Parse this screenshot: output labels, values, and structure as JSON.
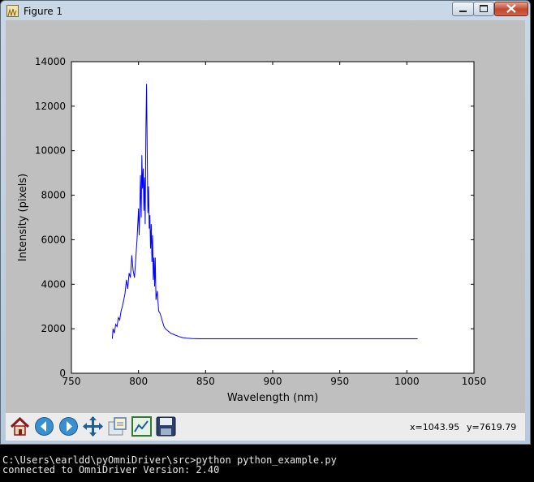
{
  "window": {
    "title": "Figure 1",
    "app_icon": "matplotlib-figure-icon"
  },
  "chart_data": {
    "type": "line",
    "title": "",
    "xlabel": "Wavelength (nm)",
    "ylabel": "Intensity (pixels)",
    "xlim": [
      750,
      1050
    ],
    "ylim": [
      0,
      14000
    ],
    "xticks": [
      "750",
      "800",
      "850",
      "900",
      "950",
      "1000",
      "1050"
    ],
    "yticks": [
      "0",
      "2000",
      "4000",
      "6000",
      "8000",
      "10000",
      "12000",
      "14000"
    ],
    "grid": false,
    "series": [
      {
        "color": "#0000ff",
        "x": [
          780.5,
          781,
          782,
          783,
          784,
          785,
          786,
          787,
          788,
          789,
          790,
          791,
          792,
          793,
          794,
          795,
          796,
          797,
          798,
          799,
          800,
          800.5,
          801,
          801.5,
          802,
          802.5,
          803,
          803.5,
          804,
          804.5,
          805,
          805.5,
          806,
          806.5,
          807,
          807.5,
          808,
          808.5,
          809,
          809.5,
          810,
          810.5,
          811,
          811.5,
          812,
          812.5,
          813,
          814,
          815,
          816,
          817,
          818,
          819,
          820,
          822,
          824,
          826,
          828,
          830,
          833,
          836,
          840,
          845,
          850,
          860,
          880,
          900,
          950,
          1000,
          1008
        ],
        "y": [
          1550,
          2000,
          1800,
          2200,
          2100,
          2500,
          2400,
          2800,
          3000,
          3300,
          3600,
          4200,
          3800,
          4500,
          4300,
          5300,
          4600,
          4300,
          5200,
          6100,
          7400,
          6200,
          7400,
          8900,
          7000,
          9800,
          8300,
          9200,
          7300,
          8800,
          6700,
          11000,
          13000,
          10000,
          7200,
          8400,
          6500,
          7100,
          5600,
          6700,
          5000,
          6200,
          4200,
          5200,
          3900,
          5200,
          3300,
          3700,
          2800,
          2700,
          2500,
          2300,
          2100,
          2000,
          1900,
          1800,
          1750,
          1700,
          1650,
          1600,
          1580,
          1560,
          1550,
          1550,
          1550,
          1550,
          1550,
          1550,
          1550,
          1550
        ]
      }
    ]
  },
  "toolbar": {
    "buttons": [
      {
        "name": "home-icon"
      },
      {
        "name": "back-icon"
      },
      {
        "name": "forward-icon"
      },
      {
        "name": "pan-icon"
      },
      {
        "name": "zoom-icon"
      },
      {
        "name": "subplots-icon"
      },
      {
        "name": "save-icon"
      }
    ],
    "x_readout": "x=1043.95",
    "y_readout": "y=7619.79"
  },
  "console": {
    "line1": "C:\\Users\\earldd\\pyOmniDriver\\src>python python_example.py",
    "line2": "connected to OmniDriver Version: 2.40"
  }
}
